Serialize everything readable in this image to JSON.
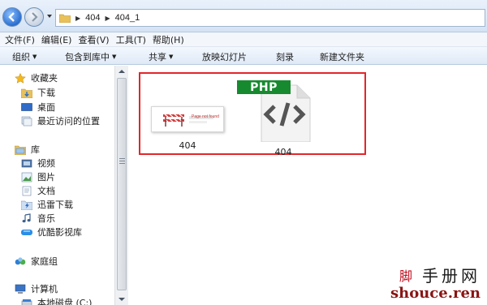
{
  "address": {
    "crumbs": [
      "404",
      "404_1"
    ]
  },
  "menu": [
    "文件(F)",
    "编辑(E)",
    "查看(V)",
    "工具(T)",
    "帮助(H)"
  ],
  "toolbar": {
    "organize": "组织",
    "include_library": "包含到库中",
    "share": "共享",
    "slideshow": "放映幻灯片",
    "burn": "刻录",
    "new_folder": "新建文件夹"
  },
  "nav": {
    "favorites": "收藏夹",
    "downloads": "下载",
    "desktop": "桌面",
    "recent": "最近访问的位置",
    "libraries": "库",
    "videos": "视频",
    "pictures": "图片",
    "documents": "文档",
    "xunlei": "迅雷下载",
    "music": "音乐",
    "youku": "优酷影视库",
    "homegroup": "家庭组",
    "computer": "计算机",
    "local_disk": "本地磁盘 (C:)"
  },
  "files": [
    {
      "name": "404",
      "type": "image"
    },
    {
      "name": "404",
      "type": "php",
      "badge": "PHP"
    }
  ],
  "thumbnail_text": "Page not found",
  "watermark": {
    "logo_text": "脚",
    "line1": "手册网",
    "line2": "shouce.ren"
  },
  "colors": {
    "highlight": "#e3262a",
    "php_badge": "#178a2f"
  }
}
